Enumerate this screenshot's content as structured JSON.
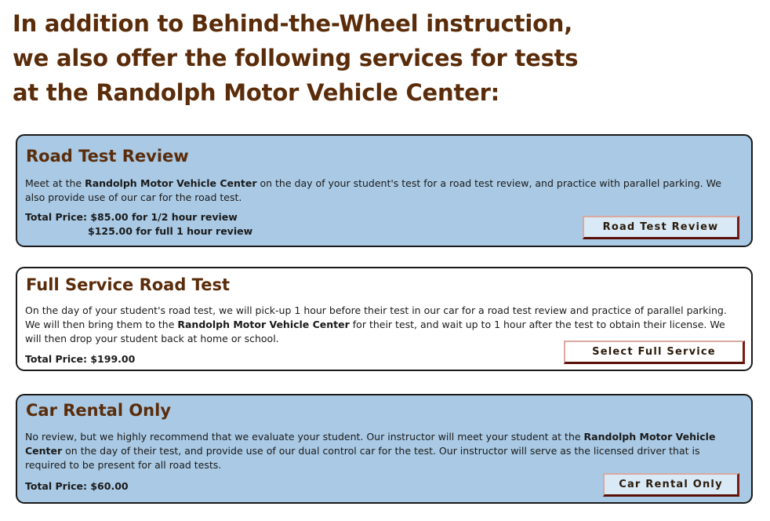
{
  "headline": {
    "line1": "In addition to Behind-the-Wheel instruction,",
    "line2": "we also offer the following services for tests",
    "line3": "at the Randolph Motor Vehicle Center:"
  },
  "services": [
    {
      "title": "Road Test Review",
      "desc_parts": [
        "Meet at the ",
        "Randolph Motor Vehicle Center",
        " on the day of your student's test for a road test review, and practice with parallel parking.  We also provide use of our car for the road test."
      ],
      "price_line1": "Total Price: $85.00 for 1/2 hour review",
      "price_line2": "$125.00 for full 1 hour review",
      "button_label": "Road Test Review"
    },
    {
      "title": "Full Service Road Test",
      "desc_parts": [
        "On the day of your student's road test, we will pick-up 1 hour before their test in our car for a road test review and practice of parallel parking. We will then bring them to the ",
        "Randolph Motor Vehicle Center",
        " for their test, and wait up to 1 hour after the test to obtain their license. We will then drop your student back at home or school."
      ],
      "price_line1": "Total Price: $199.00",
      "button_label": "Select Full Service"
    },
    {
      "title": "Car Rental Only",
      "desc_parts": [
        "No review, but we highly recommend that we evaluate your student. Our instructor will meet your student at the ",
        "Randolph Motor Vehicle Center",
        " on the day of their test, and provide use of our dual control car for the test. Our instructor will serve as the licensed driver that is required to be present for all road tests."
      ],
      "price_line1": "Total Price: $60.00",
      "button_label": "Car Rental Only"
    }
  ],
  "colors": {
    "heading_brown": "#5a2c0a",
    "card_blue": "#a9c9e4",
    "button_face": "#d9e9f6",
    "button_border_dark": "#7a1a12"
  }
}
